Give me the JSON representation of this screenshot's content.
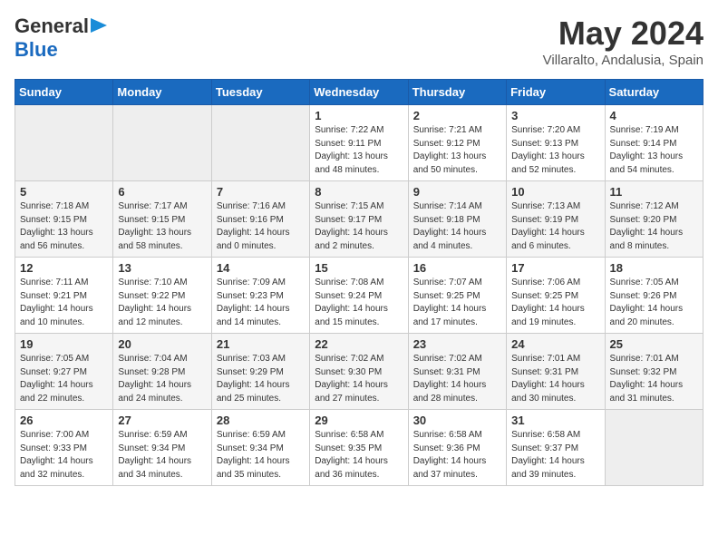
{
  "logo": {
    "text1": "General",
    "text2": "Blue"
  },
  "title": {
    "month_year": "May 2024",
    "location": "Villaralto, Andalusia, Spain"
  },
  "headers": [
    "Sunday",
    "Monday",
    "Tuesday",
    "Wednesday",
    "Thursday",
    "Friday",
    "Saturday"
  ],
  "weeks": [
    [
      {
        "day": "",
        "sunrise": "",
        "sunset": "",
        "daylight": "",
        "empty": true
      },
      {
        "day": "",
        "sunrise": "",
        "sunset": "",
        "daylight": "",
        "empty": true
      },
      {
        "day": "",
        "sunrise": "",
        "sunset": "",
        "daylight": "",
        "empty": true
      },
      {
        "day": "1",
        "sunrise": "Sunrise: 7:22 AM",
        "sunset": "Sunset: 9:11 PM",
        "daylight": "Daylight: 13 hours and 48 minutes."
      },
      {
        "day": "2",
        "sunrise": "Sunrise: 7:21 AM",
        "sunset": "Sunset: 9:12 PM",
        "daylight": "Daylight: 13 hours and 50 minutes."
      },
      {
        "day": "3",
        "sunrise": "Sunrise: 7:20 AM",
        "sunset": "Sunset: 9:13 PM",
        "daylight": "Daylight: 13 hours and 52 minutes."
      },
      {
        "day": "4",
        "sunrise": "Sunrise: 7:19 AM",
        "sunset": "Sunset: 9:14 PM",
        "daylight": "Daylight: 13 hours and 54 minutes."
      }
    ],
    [
      {
        "day": "5",
        "sunrise": "Sunrise: 7:18 AM",
        "sunset": "Sunset: 9:15 PM",
        "daylight": "Daylight: 13 hours and 56 minutes."
      },
      {
        "day": "6",
        "sunrise": "Sunrise: 7:17 AM",
        "sunset": "Sunset: 9:15 PM",
        "daylight": "Daylight: 13 hours and 58 minutes."
      },
      {
        "day": "7",
        "sunrise": "Sunrise: 7:16 AM",
        "sunset": "Sunset: 9:16 PM",
        "daylight": "Daylight: 14 hours and 0 minutes."
      },
      {
        "day": "8",
        "sunrise": "Sunrise: 7:15 AM",
        "sunset": "Sunset: 9:17 PM",
        "daylight": "Daylight: 14 hours and 2 minutes."
      },
      {
        "day": "9",
        "sunrise": "Sunrise: 7:14 AM",
        "sunset": "Sunset: 9:18 PM",
        "daylight": "Daylight: 14 hours and 4 minutes."
      },
      {
        "day": "10",
        "sunrise": "Sunrise: 7:13 AM",
        "sunset": "Sunset: 9:19 PM",
        "daylight": "Daylight: 14 hours and 6 minutes."
      },
      {
        "day": "11",
        "sunrise": "Sunrise: 7:12 AM",
        "sunset": "Sunset: 9:20 PM",
        "daylight": "Daylight: 14 hours and 8 minutes."
      }
    ],
    [
      {
        "day": "12",
        "sunrise": "Sunrise: 7:11 AM",
        "sunset": "Sunset: 9:21 PM",
        "daylight": "Daylight: 14 hours and 10 minutes."
      },
      {
        "day": "13",
        "sunrise": "Sunrise: 7:10 AM",
        "sunset": "Sunset: 9:22 PM",
        "daylight": "Daylight: 14 hours and 12 minutes."
      },
      {
        "day": "14",
        "sunrise": "Sunrise: 7:09 AM",
        "sunset": "Sunset: 9:23 PM",
        "daylight": "Daylight: 14 hours and 14 minutes."
      },
      {
        "day": "15",
        "sunrise": "Sunrise: 7:08 AM",
        "sunset": "Sunset: 9:24 PM",
        "daylight": "Daylight: 14 hours and 15 minutes."
      },
      {
        "day": "16",
        "sunrise": "Sunrise: 7:07 AM",
        "sunset": "Sunset: 9:25 PM",
        "daylight": "Daylight: 14 hours and 17 minutes."
      },
      {
        "day": "17",
        "sunrise": "Sunrise: 7:06 AM",
        "sunset": "Sunset: 9:25 PM",
        "daylight": "Daylight: 14 hours and 19 minutes."
      },
      {
        "day": "18",
        "sunrise": "Sunrise: 7:05 AM",
        "sunset": "Sunset: 9:26 PM",
        "daylight": "Daylight: 14 hours and 20 minutes."
      }
    ],
    [
      {
        "day": "19",
        "sunrise": "Sunrise: 7:05 AM",
        "sunset": "Sunset: 9:27 PM",
        "daylight": "Daylight: 14 hours and 22 minutes."
      },
      {
        "day": "20",
        "sunrise": "Sunrise: 7:04 AM",
        "sunset": "Sunset: 9:28 PM",
        "daylight": "Daylight: 14 hours and 24 minutes."
      },
      {
        "day": "21",
        "sunrise": "Sunrise: 7:03 AM",
        "sunset": "Sunset: 9:29 PM",
        "daylight": "Daylight: 14 hours and 25 minutes."
      },
      {
        "day": "22",
        "sunrise": "Sunrise: 7:02 AM",
        "sunset": "Sunset: 9:30 PM",
        "daylight": "Daylight: 14 hours and 27 minutes."
      },
      {
        "day": "23",
        "sunrise": "Sunrise: 7:02 AM",
        "sunset": "Sunset: 9:31 PM",
        "daylight": "Daylight: 14 hours and 28 minutes."
      },
      {
        "day": "24",
        "sunrise": "Sunrise: 7:01 AM",
        "sunset": "Sunset: 9:31 PM",
        "daylight": "Daylight: 14 hours and 30 minutes."
      },
      {
        "day": "25",
        "sunrise": "Sunrise: 7:01 AM",
        "sunset": "Sunset: 9:32 PM",
        "daylight": "Daylight: 14 hours and 31 minutes."
      }
    ],
    [
      {
        "day": "26",
        "sunrise": "Sunrise: 7:00 AM",
        "sunset": "Sunset: 9:33 PM",
        "daylight": "Daylight: 14 hours and 32 minutes."
      },
      {
        "day": "27",
        "sunrise": "Sunrise: 6:59 AM",
        "sunset": "Sunset: 9:34 PM",
        "daylight": "Daylight: 14 hours and 34 minutes."
      },
      {
        "day": "28",
        "sunrise": "Sunrise: 6:59 AM",
        "sunset": "Sunset: 9:34 PM",
        "daylight": "Daylight: 14 hours and 35 minutes."
      },
      {
        "day": "29",
        "sunrise": "Sunrise: 6:58 AM",
        "sunset": "Sunset: 9:35 PM",
        "daylight": "Daylight: 14 hours and 36 minutes."
      },
      {
        "day": "30",
        "sunrise": "Sunrise: 6:58 AM",
        "sunset": "Sunset: 9:36 PM",
        "daylight": "Daylight: 14 hours and 37 minutes."
      },
      {
        "day": "31",
        "sunrise": "Sunrise: 6:58 AM",
        "sunset": "Sunset: 9:37 PM",
        "daylight": "Daylight: 14 hours and 39 minutes."
      },
      {
        "day": "",
        "sunrise": "",
        "sunset": "",
        "daylight": "",
        "empty": true
      }
    ]
  ]
}
